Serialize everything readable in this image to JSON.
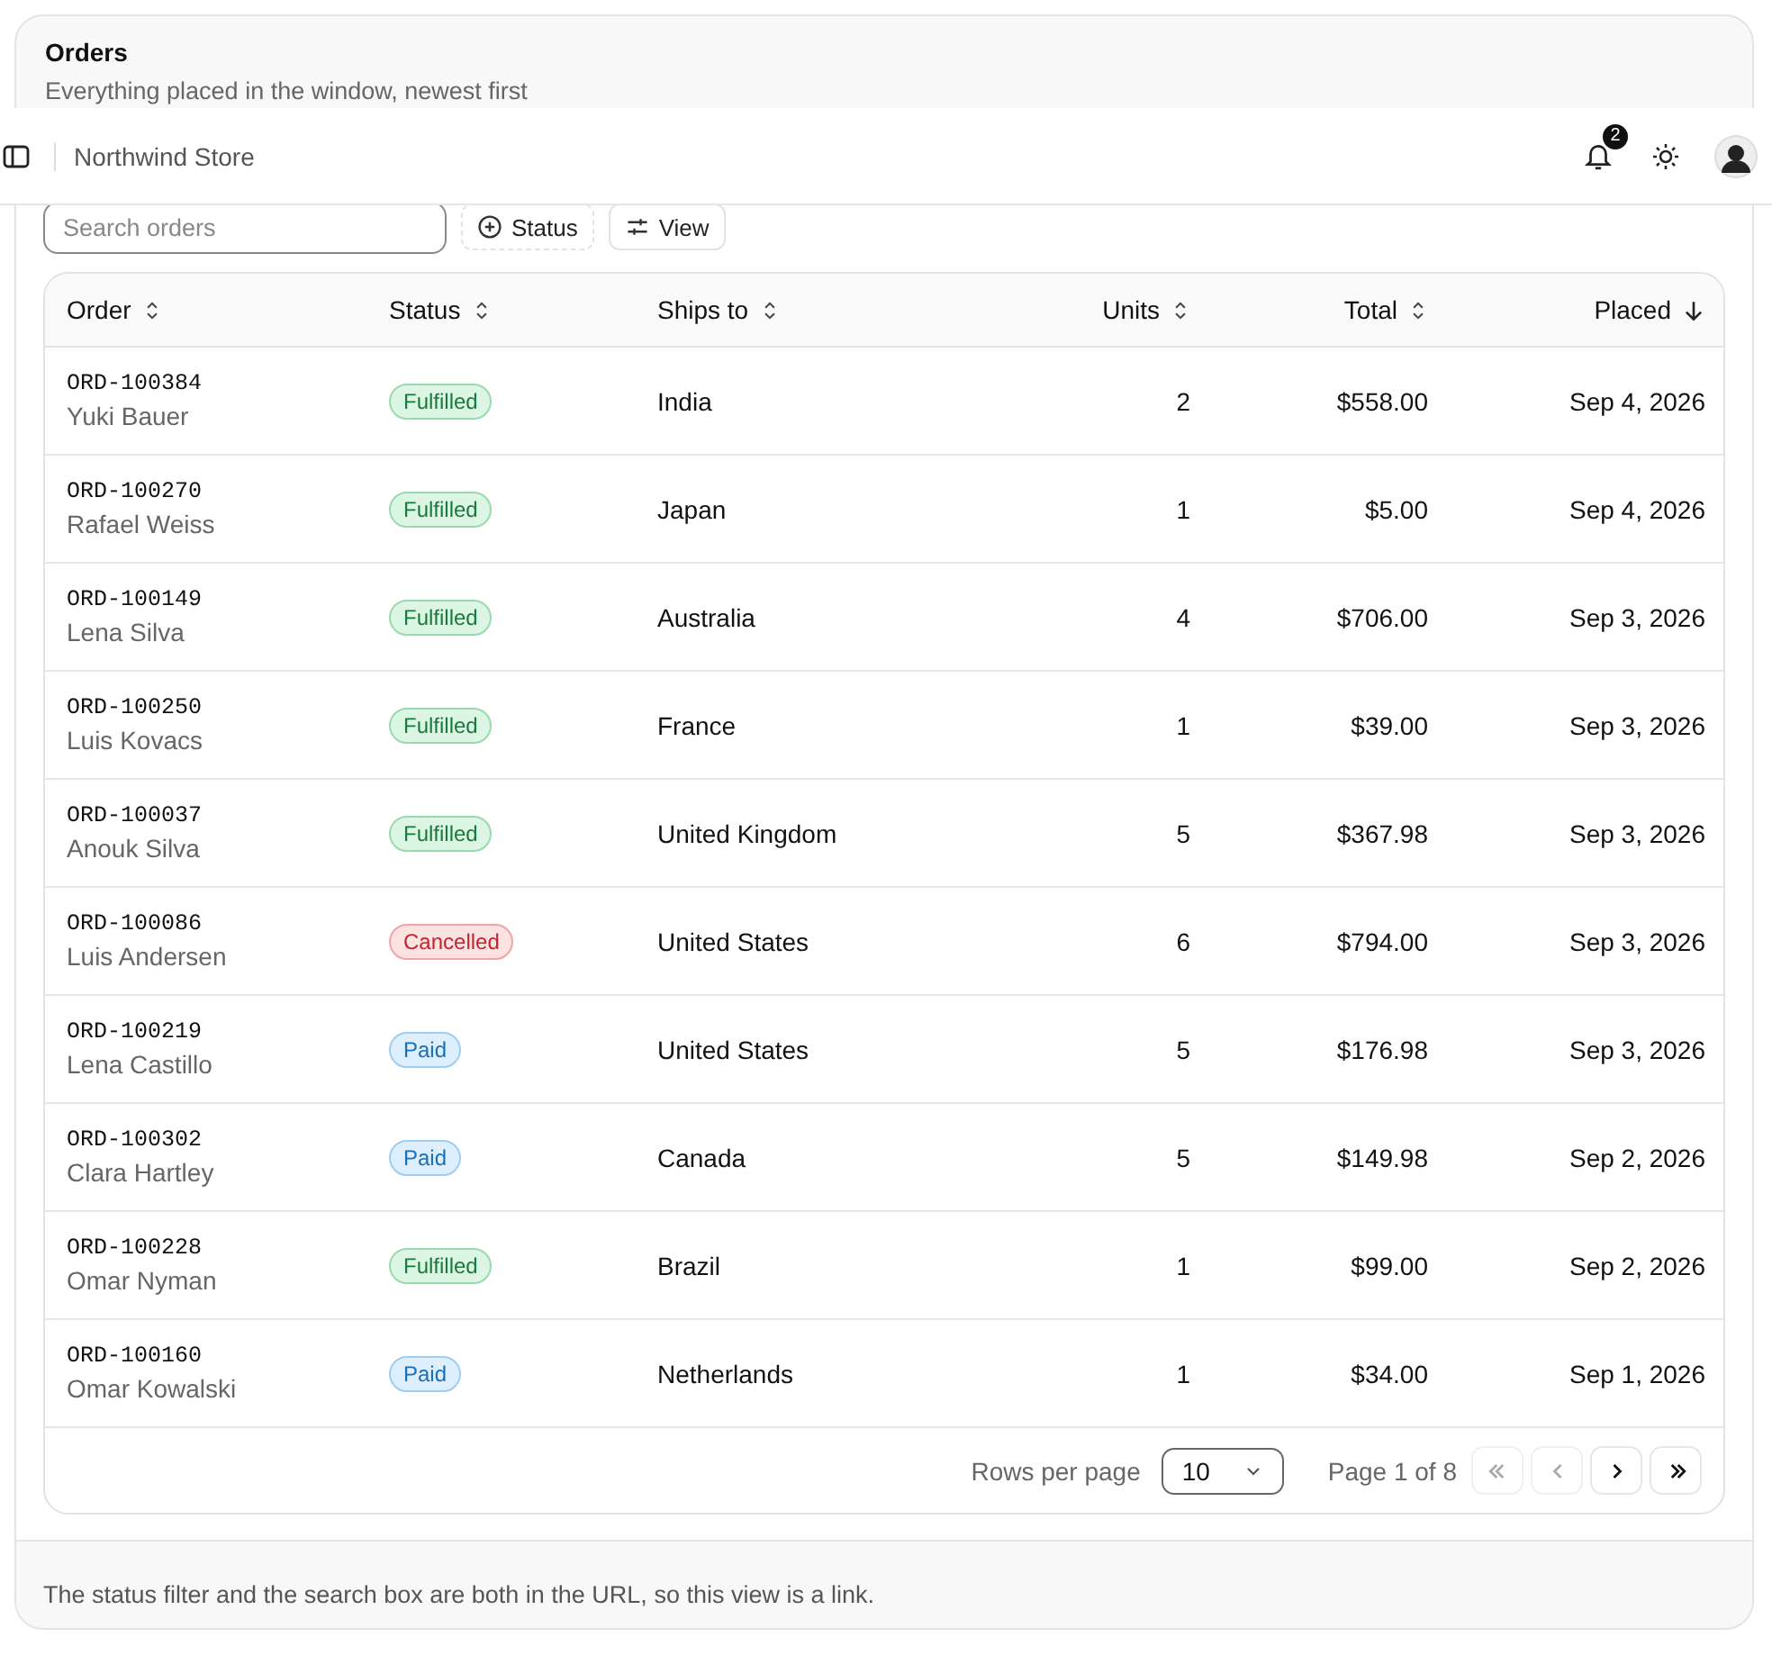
{
  "card": {
    "title": "Orders",
    "subtitle": "Everything placed in the window, newest first"
  },
  "topbar": {
    "title": "Northwind Store",
    "notification_count": "2"
  },
  "toolbar": {
    "search": {
      "placeholder": "Search orders"
    },
    "buttons": [
      {
        "label": "Status",
        "kind": "filter"
      },
      {
        "label": "View",
        "kind": "view"
      }
    ]
  },
  "table": {
    "columns": [
      {
        "label": "Order",
        "sorted": false
      },
      {
        "label": "Status",
        "sorted": false
      },
      {
        "label": "Ships to",
        "sorted": false
      },
      {
        "label": "Units",
        "sorted": false
      },
      {
        "label": "Total",
        "sorted": false
      },
      {
        "label": "Placed",
        "sorted": true
      }
    ],
    "rows": [
      {
        "order": "ORD-100384",
        "customer": "Yuki Bauer",
        "status": {
          "label": "Fulfilled",
          "kind": "fulfilled"
        },
        "ships_to": "India",
        "units": "2",
        "total": "$558.00",
        "placed": "Sep 4, 2026"
      },
      {
        "order": "ORD-100270",
        "customer": "Rafael Weiss",
        "status": {
          "label": "Fulfilled",
          "kind": "fulfilled"
        },
        "ships_to": "Japan",
        "units": "1",
        "total": "$5.00",
        "placed": "Sep 4, 2026"
      },
      {
        "order": "ORD-100149",
        "customer": "Lena Silva",
        "status": {
          "label": "Fulfilled",
          "kind": "fulfilled"
        },
        "ships_to": "Australia",
        "units": "4",
        "total": "$706.00",
        "placed": "Sep 3, 2026"
      },
      {
        "order": "ORD-100250",
        "customer": "Luis Kovacs",
        "status": {
          "label": "Fulfilled",
          "kind": "fulfilled"
        },
        "ships_to": "France",
        "units": "1",
        "total": "$39.00",
        "placed": "Sep 3, 2026"
      },
      {
        "order": "ORD-100037",
        "customer": "Anouk Silva",
        "status": {
          "label": "Fulfilled",
          "kind": "fulfilled"
        },
        "ships_to": "United Kingdom",
        "units": "5",
        "total": "$367.98",
        "placed": "Sep 3, 2026"
      },
      {
        "order": "ORD-100086",
        "customer": "Luis Andersen",
        "status": {
          "label": "Cancelled",
          "kind": "cancelled"
        },
        "ships_to": "United States",
        "units": "6",
        "total": "$794.00",
        "placed": "Sep 3, 2026"
      },
      {
        "order": "ORD-100219",
        "customer": "Lena Castillo",
        "status": {
          "label": "Paid",
          "kind": "paid"
        },
        "ships_to": "United States",
        "units": "5",
        "total": "$176.98",
        "placed": "Sep 3, 2026"
      },
      {
        "order": "ORD-100302",
        "customer": "Clara Hartley",
        "status": {
          "label": "Paid",
          "kind": "paid"
        },
        "ships_to": "Canada",
        "units": "5",
        "total": "$149.98",
        "placed": "Sep 2, 2026"
      },
      {
        "order": "ORD-100228",
        "customer": "Omar Nyman",
        "status": {
          "label": "Fulfilled",
          "kind": "fulfilled"
        },
        "ships_to": "Brazil",
        "units": "1",
        "total": "$99.00",
        "placed": "Sep 2, 2026"
      },
      {
        "order": "ORD-100160",
        "customer": "Omar Kowalski",
        "status": {
          "label": "Paid",
          "kind": "paid"
        },
        "ships_to": "Netherlands",
        "units": "1",
        "total": "$34.00",
        "placed": "Sep 1, 2026"
      }
    ]
  },
  "pagination": {
    "rows_label": "Rows per page",
    "rows_value": "10",
    "page_label": "Page 1 of 8",
    "buttons": [
      {
        "kind": "first",
        "disabled": true
      },
      {
        "kind": "previous",
        "disabled": true
      },
      {
        "kind": "next",
        "disabled": false
      },
      {
        "kind": "last",
        "disabled": false
      }
    ]
  },
  "footer": {
    "note": "The status filter and the search box are both in the URL, so this view is a link."
  }
}
